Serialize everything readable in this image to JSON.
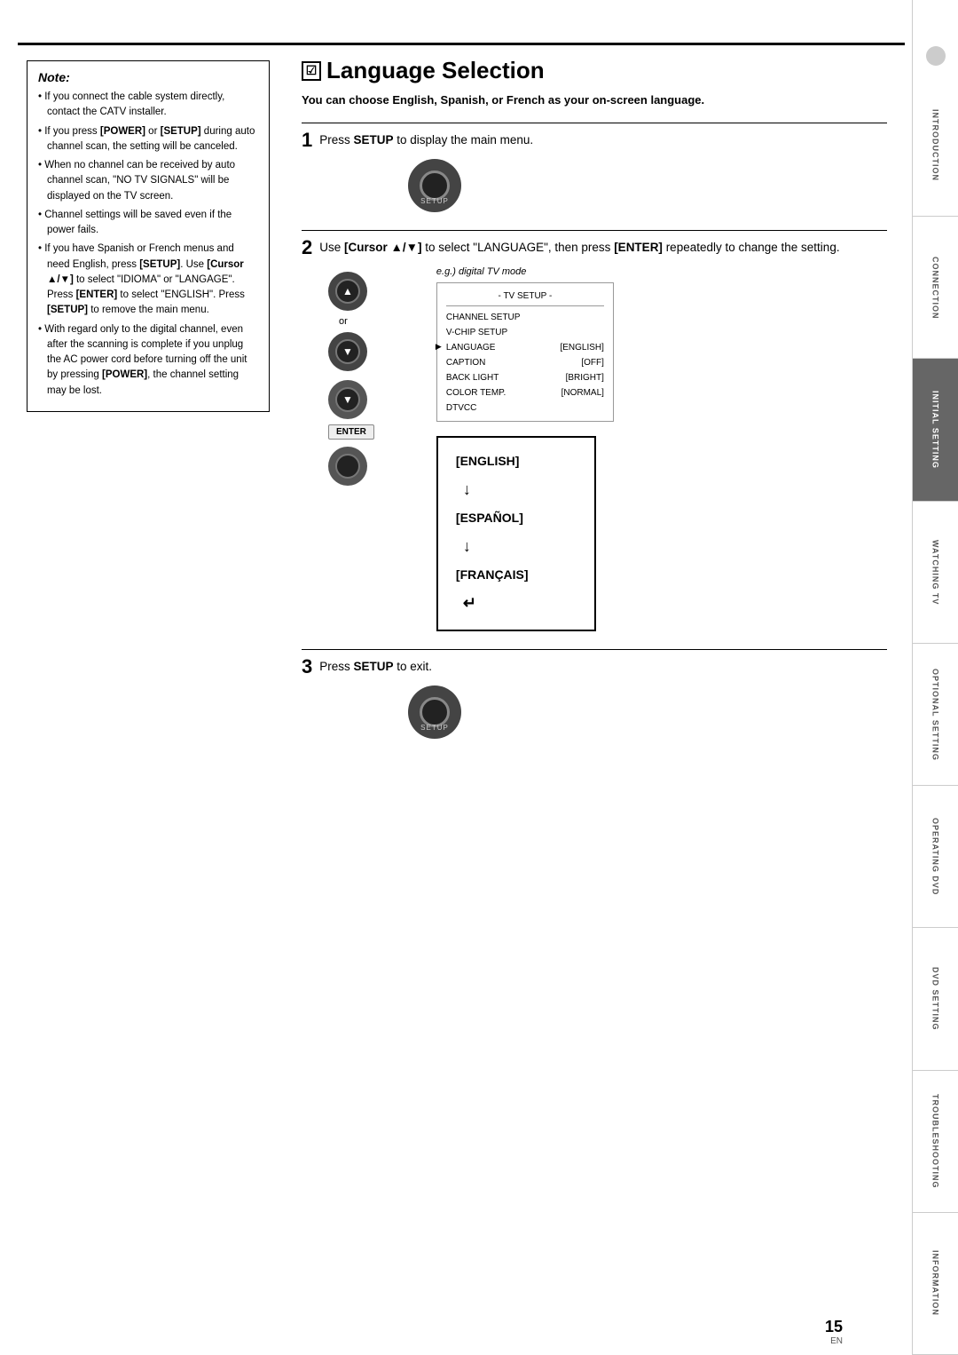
{
  "top_border": true,
  "sidebar": {
    "sections": [
      {
        "id": "introduction",
        "label": "INTRODUCTION",
        "active": false
      },
      {
        "id": "connection",
        "label": "CONNECTION",
        "active": false
      },
      {
        "id": "initial_setting",
        "label": "INITIAL SETTING",
        "active": true
      },
      {
        "id": "watching_tv",
        "label": "WATCHING TV",
        "active": false
      },
      {
        "id": "optional_setting",
        "label": "OPTIONAL SETTING",
        "active": false
      },
      {
        "id": "operating_dvd",
        "label": "OPERATING DVD",
        "active": false
      },
      {
        "id": "dvd_setting",
        "label": "DVD SETTING",
        "active": false
      },
      {
        "id": "troubleshooting",
        "label": "TROUBLESHOOTING",
        "active": false
      },
      {
        "id": "information",
        "label": "INFORMATION",
        "active": false
      }
    ]
  },
  "page_title": "Language Selection",
  "page_subtitle": "You can choose English, Spanish, or French as your on-screen language.",
  "note": {
    "title": "Note:",
    "items": [
      "If you connect the cable system directly, contact the CATV installer.",
      "If you press POWER or SETUP during auto channel scan, the setting will be canceled.",
      "When no channel can be received by auto channel scan, \"NO TV SIGNALS\" will be displayed on the TV screen.",
      "Channel settings will be saved even if the power fails.",
      "If you have Spanish or French menus and need English, press SETUP. Use [Cursor ▲/▼] to select \"IDIOMA\" or \"LANGAGE\". Press [ENTER] to select \"ENGLISH\". Press [SETUP] to remove the main menu.",
      "With regard only to the digital channel, even after the scanning is complete if you unplug the AC power cord before turning off the unit by pressing POWER, the channel setting may be lost."
    ]
  },
  "steps": [
    {
      "number": "1",
      "text": "Press SETUP to display the main menu.",
      "button_label": "SETUP"
    },
    {
      "number": "2",
      "text_part1": "Use [Cursor ▲/▼] to select \"LANGUAGE\", then press",
      "text_part2": "[ENTER] repeatedly to change the setting.",
      "eg_label": "e.g.) digital TV mode",
      "menu": {
        "title": "- TV SETUP -",
        "rows": [
          {
            "label": "CHANNEL SETUP",
            "value": "",
            "active": false
          },
          {
            "label": "V-CHIP  SETUP",
            "value": "",
            "active": false
          },
          {
            "label": "LANGUAGE",
            "value": "[ENGLISH]",
            "active": true
          },
          {
            "label": "CAPTION",
            "value": "[OFF]",
            "active": false
          },
          {
            "label": "BACK  LIGHT",
            "value": "[BRIGHT]",
            "active": false
          },
          {
            "label": "COLOR  TEMP.",
            "value": "[NORMAL]",
            "active": false
          },
          {
            "label": "DTVCC",
            "value": "",
            "active": false
          }
        ]
      },
      "languages": [
        {
          "label": "[ENGLISH]",
          "arrow": "↓"
        },
        {
          "label": "[ESPAÑOL]",
          "arrow": "↓"
        },
        {
          "label": "[FRANÇAIS]",
          "arrow": ""
        }
      ]
    },
    {
      "number": "3",
      "text": "Press SETUP to exit.",
      "button_label": "SETUP"
    }
  ],
  "page_number": "15",
  "page_lang": "EN"
}
